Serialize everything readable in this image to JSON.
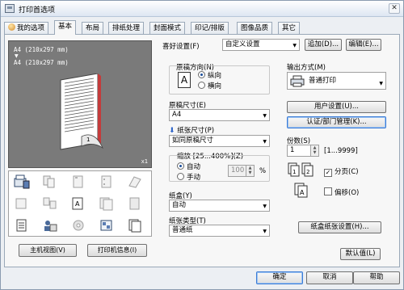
{
  "window": {
    "title": "打印首选项",
    "close": "✕"
  },
  "tabs": [
    "我的选项",
    "基本",
    "布局",
    "排纸处理",
    "封面模式",
    "印记/排版",
    "图像品质",
    "其它"
  ],
  "preview": {
    "size_line1": "A4 (210x297 mm)",
    "size_line2": "A4 (210x297 mm)",
    "arrow": "▼",
    "copies_badge": "x1",
    "page_number": "1"
  },
  "bottom_left": {
    "host_view": "主机视图(V)",
    "printer_info": "打印机信息(I)"
  },
  "favorites": {
    "label": "喜好设置(F)",
    "value": "自定义设置",
    "add": "追加(D)...",
    "edit": "编辑(E)..."
  },
  "orientation": {
    "label": "原稿方向(N)",
    "portrait": "纵向",
    "landscape": "横向",
    "glyph": "A"
  },
  "original_size": {
    "label": "原稿尺寸(E)",
    "value": "A4"
  },
  "paper_size": {
    "label": "纸张尺寸(P)",
    "value": "如同原稿尺寸"
  },
  "zoom": {
    "label": "缩放 [25...400%](Z)",
    "auto": "自动",
    "manual": "手动",
    "value": "100",
    "unit": "%"
  },
  "paper_tray": {
    "label": "纸盒(Y)",
    "value": "自动"
  },
  "paper_type": {
    "label": "纸张类型(T)",
    "value": "普通纸"
  },
  "output_method": {
    "label": "输出方式(M)",
    "value": "普通打印"
  },
  "user_settings": "用户设置(U)...",
  "auth": "认证/部门管理(K)...",
  "copies": {
    "label": "份数(S)",
    "value": "1",
    "range": "[1...9999]"
  },
  "collate": {
    "label": "分页(C)",
    "checked": true
  },
  "offset": {
    "label": "偏移(O)",
    "checked": false
  },
  "tray_paper_settings": "纸盒纸张设置(H)...",
  "defaults": "默认值(L)",
  "dialog": {
    "ok": "确定",
    "cancel": "取消",
    "help": "帮助"
  }
}
